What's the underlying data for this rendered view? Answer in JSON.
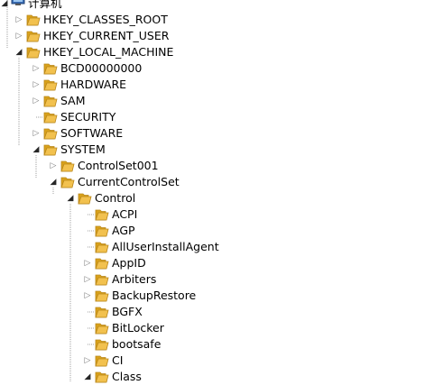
{
  "colors": {
    "folder_front": "#f2c14e",
    "folder_back": "#d9a21b",
    "folder_edge": "#b9861a",
    "guide_line": "#a0a0a0",
    "expander": "#7a7a7a"
  },
  "tree": {
    "root": {
      "label": "计算机",
      "icon": "computer-icon",
      "expanded": true
    },
    "nodes": [
      {
        "label": "HKEY_CLASSES_ROOT",
        "icon": "folder-icon",
        "expander": "collapsed"
      },
      {
        "label": "HKEY_CURRENT_USER",
        "icon": "folder-icon",
        "expander": "collapsed"
      },
      {
        "label": "HKEY_LOCAL_MACHINE",
        "icon": "folder-icon",
        "expander": "expanded"
      },
      {
        "label": "BCD00000000",
        "icon": "folder-icon",
        "expander": "collapsed"
      },
      {
        "label": "HARDWARE",
        "icon": "folder-icon",
        "expander": "collapsed"
      },
      {
        "label": "SAM",
        "icon": "folder-icon",
        "expander": "collapsed"
      },
      {
        "label": "SECURITY",
        "icon": "folder-icon",
        "expander": "none"
      },
      {
        "label": "SOFTWARE",
        "icon": "folder-icon",
        "expander": "collapsed"
      },
      {
        "label": "SYSTEM",
        "icon": "folder-icon",
        "expander": "expanded"
      },
      {
        "label": "ControlSet001",
        "icon": "folder-icon",
        "expander": "collapsed"
      },
      {
        "label": "CurrentControlSet",
        "icon": "folder-icon",
        "expander": "expanded"
      },
      {
        "label": "Control",
        "icon": "folder-icon",
        "expander": "expanded"
      },
      {
        "label": "ACPI",
        "icon": "folder-icon",
        "expander": "none"
      },
      {
        "label": "AGP",
        "icon": "folder-icon",
        "expander": "none"
      },
      {
        "label": "AllUserInstallAgent",
        "icon": "folder-icon",
        "expander": "none"
      },
      {
        "label": "AppID",
        "icon": "folder-icon",
        "expander": "collapsed"
      },
      {
        "label": "Arbiters",
        "icon": "folder-icon",
        "expander": "collapsed"
      },
      {
        "label": "BackupRestore",
        "icon": "folder-icon",
        "expander": "collapsed"
      },
      {
        "label": "BGFX",
        "icon": "folder-icon",
        "expander": "none"
      },
      {
        "label": "BitLocker",
        "icon": "folder-icon",
        "expander": "none"
      },
      {
        "label": "bootsafe",
        "icon": "folder-icon",
        "expander": "none"
      },
      {
        "label": "CI",
        "icon": "folder-icon",
        "expander": "collapsed"
      },
      {
        "label": "Class",
        "icon": "folder-icon",
        "expander": "expanded"
      }
    ]
  }
}
